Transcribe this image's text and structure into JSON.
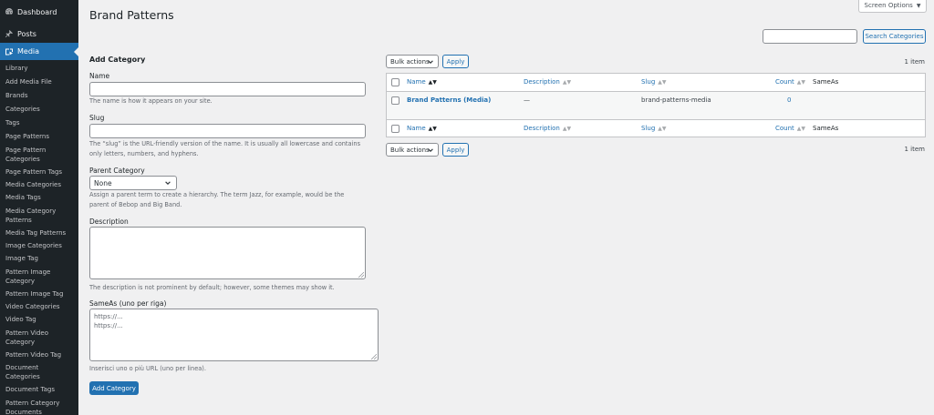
{
  "sidebar": {
    "dashboard": "Dashboard",
    "posts": "Posts",
    "media": "Media",
    "submenu": [
      {
        "label": "Library"
      },
      {
        "label": "Add Media File"
      },
      {
        "label": "Brands"
      },
      {
        "label": "Categories"
      },
      {
        "label": "Tags"
      },
      {
        "label": "Page Patterns"
      },
      {
        "label": "Page Pattern Categories"
      },
      {
        "label": "Page Pattern Tags"
      },
      {
        "label": "Media Categories"
      },
      {
        "label": "Media Tags"
      },
      {
        "label": "Media Category Patterns"
      },
      {
        "label": "Media Tag Patterns"
      },
      {
        "label": "Image Categories"
      },
      {
        "label": "Image Tag"
      },
      {
        "label": "Pattern Image Category"
      },
      {
        "label": "Pattern Image Tag"
      },
      {
        "label": "Video Categories"
      },
      {
        "label": "Video Tag"
      },
      {
        "label": "Pattern Video Category"
      },
      {
        "label": "Pattern Video Tag"
      },
      {
        "label": "Document Categories"
      },
      {
        "label": "Document Tags"
      },
      {
        "label": "Pattern Category Documents"
      }
    ]
  },
  "page": {
    "title": "Brand Patterns",
    "screen_options": "Screen Options",
    "search_button": "Search Categories"
  },
  "form": {
    "heading": "Add Category",
    "name_label": "Name",
    "name_help": "The name is how it appears on your site.",
    "slug_label": "Slug",
    "slug_help": "The “slug” is the URL-friendly version of the name. It is usually all lowercase and contains only letters, numbers, and hyphens.",
    "parent_label": "Parent Category",
    "parent_value": "None",
    "parent_help": "Assign a parent term to create a hierarchy. The term Jazz, for example, would be the parent of Bebop and Big Band.",
    "description_label": "Description",
    "description_help": "The description is not prominent by default; however, some themes may show it.",
    "sameas_label": "SameAs (uno per riga)",
    "sameas_placeholder_1": "https://...",
    "sameas_placeholder_2": "https://...",
    "sameas_help": "Inserisci uno o più URL (uno per linea).",
    "submit": "Add Category"
  },
  "table": {
    "bulk_actions": "Bulk actions",
    "apply": "Apply",
    "items_count": "1 item",
    "columns": {
      "name": "Name",
      "description": "Description",
      "slug": "Slug",
      "count": "Count",
      "sameas": "SameAs"
    },
    "rows": [
      {
        "name": "Brand Patterns (Media)",
        "description": "—",
        "slug": "brand-patterns-media",
        "count": "0",
        "sameas": ""
      }
    ]
  },
  "icons": {
    "dashboard": "dashboard-icon",
    "posts": "pin-icon",
    "media": "media-icon"
  },
  "colors": {
    "accent": "#2271b1",
    "sidebar_bg": "#1d2327",
    "page_bg": "#f0f0f1"
  }
}
